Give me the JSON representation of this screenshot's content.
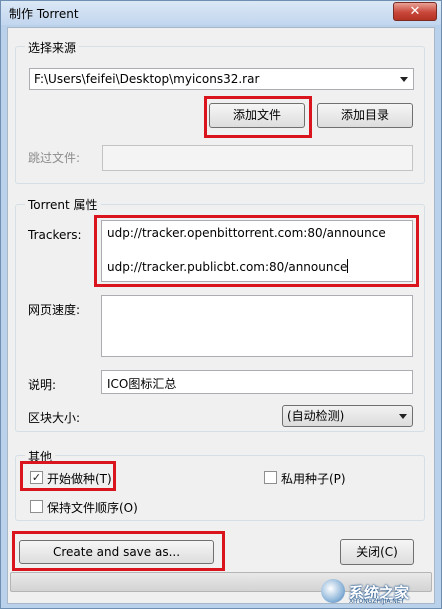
{
  "window": {
    "title": "制作 Torrent",
    "close_symbol": "✕"
  },
  "source": {
    "group_title": "选择来源",
    "path_value": "F:\\Users\\feifei\\Desktop\\myicons32.rar",
    "add_file_label": "添加文件",
    "add_dir_label": "添加目录",
    "skip_label": "跳过文件:",
    "skip_value": ""
  },
  "props": {
    "group_title": "Torrent 属性",
    "trackers_label": "Trackers:",
    "trackers": [
      "udp://tracker.openbittorrent.com:80/announce",
      "udp://tracker.publicbt.com:80/announce"
    ],
    "webseed_label": "网页速度:",
    "webseed_value": "",
    "comment_label": "说明:",
    "comment_value": "ICO图标汇总",
    "piece_label": "区块大小:",
    "piece_value": "(自动检测)"
  },
  "other": {
    "group_title": "其他",
    "start_seeding_label": "开始做种(T)",
    "start_seeding_checked": true,
    "private_label": "私用种子(P)",
    "private_checked": false,
    "preserve_order_label": "保持文件顺序(O)",
    "preserve_order_checked": false
  },
  "actions": {
    "create_label": "Create and save as...",
    "close_label": "关闭(C)"
  },
  "progress": {
    "value": 0
  },
  "watermark": {
    "text": "系统之家",
    "sub": "XITONGZHIJIA.NET"
  },
  "colors": {
    "highlight": "#d9141d",
    "window_frame": "#b9d1ea"
  }
}
